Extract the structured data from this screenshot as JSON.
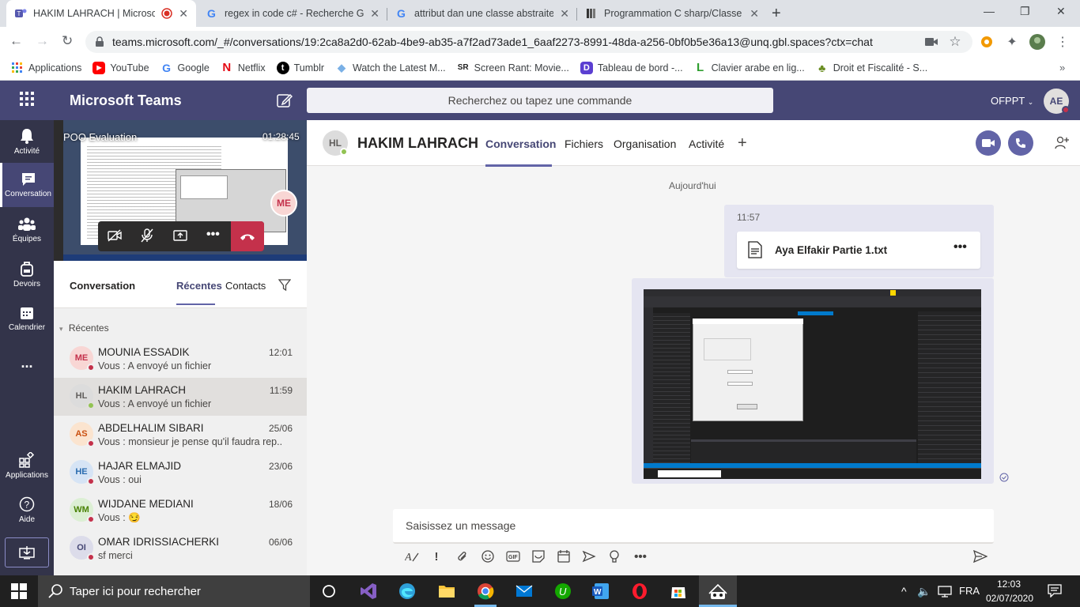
{
  "browser": {
    "tabs": [
      {
        "title": "HAKIM LAHRACH | Microsof",
        "favicon_color": "#5558af"
      },
      {
        "title": "regex in code c# - Recherche Go",
        "favicon_color": "#4285f4"
      },
      {
        "title": "attribut dan une classe abstraite",
        "favicon_color": "#4285f4"
      },
      {
        "title": "Programmation C sharp/Classe a",
        "favicon_color": "#333333"
      }
    ],
    "url": "teams.microsoft.com/_#/conversations/19:2ca8a2d0-62ab-4be9-ab35-a7f2ad73ade1_6aaf2273-8991-48da-a256-0bf0b5e36a13@unq.gbl.spaces?ctx=chat",
    "bookmarks": [
      {
        "label": "Applications",
        "icon": "apps-grid-icon",
        "color": "#4285f4"
      },
      {
        "label": "YouTube",
        "icon": "youtube-icon",
        "color": "#ff0000"
      },
      {
        "label": "Google",
        "icon": "google-icon",
        "color": "#4285f4"
      },
      {
        "label": "Netflix",
        "icon": "netflix-icon",
        "color": "#e50914"
      },
      {
        "label": "Tumblr",
        "icon": "tumblr-icon",
        "color": "#000000"
      },
      {
        "label": "Watch the Latest M...",
        "icon": "watch-icon",
        "color": "#7ab0e6"
      },
      {
        "label": "Screen Rant: Movie...",
        "icon": "screenrant-icon",
        "color": "#222222"
      },
      {
        "label": "Tableau de bord -...",
        "icon": "dashboard-icon",
        "color": "#5b3fd1"
      },
      {
        "label": "Clavier arabe en lig...",
        "icon": "keyboard-icon",
        "color": "#2e9e2e"
      },
      {
        "label": "Droit et Fiscalité - S...",
        "icon": "tree-icon",
        "color": "#6b8e23"
      }
    ]
  },
  "teams": {
    "app_title": "Microsoft Teams",
    "search_placeholder": "Recherchez ou tapez une commande",
    "org": "OFPPT",
    "user_initials": "AE",
    "brand_color": "#464775",
    "accent_color": "#6264a7"
  },
  "rail": [
    {
      "label": "Activité",
      "icon": "bell-icon"
    },
    {
      "label": "Conversation",
      "icon": "chat-icon",
      "selected": true
    },
    {
      "label": "Équipes",
      "icon": "teams-icon"
    },
    {
      "label": "Devoirs",
      "icon": "backpack-icon"
    },
    {
      "label": "Calendrier",
      "icon": "calendar-icon"
    },
    {
      "label": "...",
      "icon": "more-icon"
    },
    {
      "label": "Applications",
      "icon": "apps-icon"
    },
    {
      "label": "Aide",
      "icon": "help-icon"
    }
  ],
  "call": {
    "title": "POO Evaluation",
    "duration": "01:28:45",
    "participant_initials": "ME"
  },
  "list": {
    "title": "Conversation",
    "tabs": [
      "Récentes",
      "Contacts"
    ],
    "section": "Récentes",
    "chats": [
      {
        "initials": "ME",
        "name": "MOUNIA ESSADIK",
        "preview": "Vous : A envoyé un fichier",
        "time": "12:01",
        "avatar_bg": "#f8d6d4",
        "avatar_fg": "#c4314b",
        "presence": "#c4314b"
      },
      {
        "initials": "HL",
        "name": "HAKIM LAHRACH",
        "preview": "Vous : A envoyé un fichier",
        "time": "11:59",
        "avatar_bg": "#dcdcdc",
        "avatar_fg": "#605e5c",
        "presence": "#92c353",
        "selected": true
      },
      {
        "initials": "AS",
        "name": "ABDELHALIM SIBARI",
        "preview": "Vous : monsieur je pense qu'il faudra rep...",
        "time": "25/06",
        "avatar_bg": "#fbe4cf",
        "avatar_fg": "#ca5010",
        "presence": "#c4314b"
      },
      {
        "initials": "HE",
        "name": "HAJAR ELMAJID",
        "preview": "Vous : oui",
        "time": "23/06",
        "avatar_bg": "#d6e4f5",
        "avatar_fg": "#2b6cb0",
        "presence": "#c4314b"
      },
      {
        "initials": "WM",
        "name": "WIJDANE MEDIANI",
        "preview": "Vous : 😏",
        "time": "18/06",
        "avatar_bg": "#dcefd4",
        "avatar_fg": "#498205",
        "presence": "#c4314b"
      },
      {
        "initials": "OI",
        "name": "OMAR IDRISSIACHERKI",
        "preview": "sf merci",
        "time": "06/06",
        "avatar_bg": "#dcdcea",
        "avatar_fg": "#464775",
        "presence": "#c4314b"
      }
    ]
  },
  "chat": {
    "initials": "HL",
    "name": "HAKIM LAHRACH",
    "tabs": [
      "Conversation",
      "Fichiers",
      "Organisation",
      "Activité"
    ],
    "date_divider": "Aujourd'hui",
    "message_time": "11:57",
    "file_name": "Aya Elfakir Partie 1.txt",
    "composer_placeholder": "Saisissez un message"
  },
  "taskbar": {
    "search_placeholder": "Taper ici pour rechercher",
    "language": "FRA",
    "time": "12:03",
    "date": "02/07/2020"
  }
}
